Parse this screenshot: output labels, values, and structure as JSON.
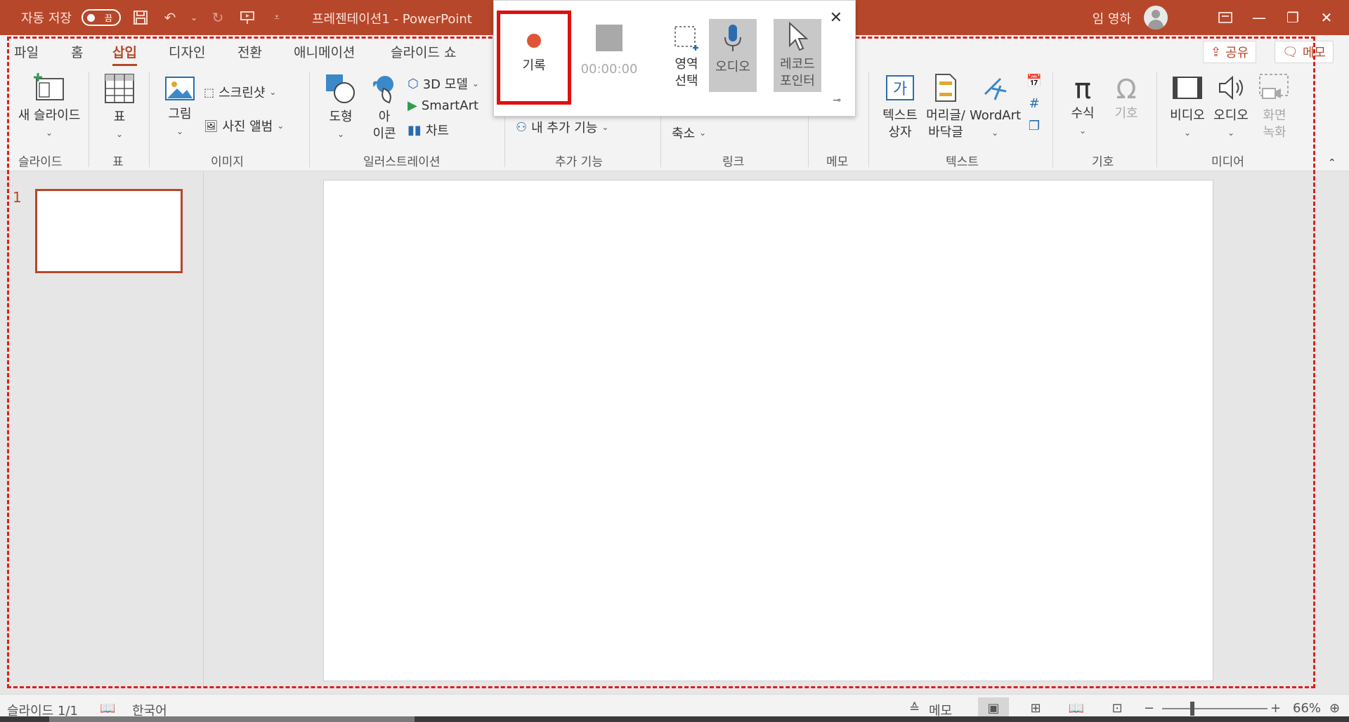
{
  "titlebar": {
    "autosave_label": "자동 저장",
    "autosave_toggle": "끔",
    "doc_title": "프레젠테이션1  -  PowerPoint",
    "user_name": "임 영하"
  },
  "tabs": [
    "파일",
    "홈",
    "삽입",
    "디자인",
    "전환",
    "애니메이션",
    "슬라이드 쇼"
  ],
  "active_tab": "삽입",
  "share_label": "공유",
  "memo_label": "메모",
  "ribbon": {
    "groups": {
      "slide": "슬라이드",
      "table": "표",
      "image": "이미지",
      "illustration": "일러스트레이션",
      "addins": "추가 기능",
      "link": "링크",
      "memo": "메모",
      "text": "텍스트",
      "symbol": "기호",
      "media": "미디어"
    },
    "new_slide": "새 슬라이드",
    "table": "표",
    "picture": "그림",
    "screenshot": "스크린샷",
    "photo_album": "사진 앨범",
    "shapes": "도형",
    "icons_line1": "아",
    "icons_line2": "이콘",
    "model3d": "3D 모델",
    "smartart": "SmartArt",
    "chart": "차트",
    "my_addins": "내 추가 기능",
    "zoom": "축소",
    "textbox_line1": "텍스트",
    "textbox_line2": "상자",
    "header_line1": "머리글/",
    "header_line2": "바닥글",
    "wordart": "WordArt",
    "equation": "수식",
    "symbol": "기호",
    "video": "비디오",
    "audio": "오디오",
    "screen_rec_line1": "화면",
    "screen_rec_line2": "녹화"
  },
  "recording_toolbar": {
    "record": "기록",
    "timer": "00:00:00",
    "select_area_line1": "영역",
    "select_area_line2": "선택",
    "audio": "오디오",
    "pointer_line1": "레코드",
    "pointer_line2": "포인터"
  },
  "slides_pane": {
    "slide_number": "1"
  },
  "statusbar": {
    "slide_info": "슬라이드 1/1",
    "language": "한국어",
    "notes": "메모",
    "zoom": "66%"
  },
  "colors": {
    "accent": "#b7472a",
    "record_red": "#e01010",
    "region_dash": "#e01e1e"
  }
}
